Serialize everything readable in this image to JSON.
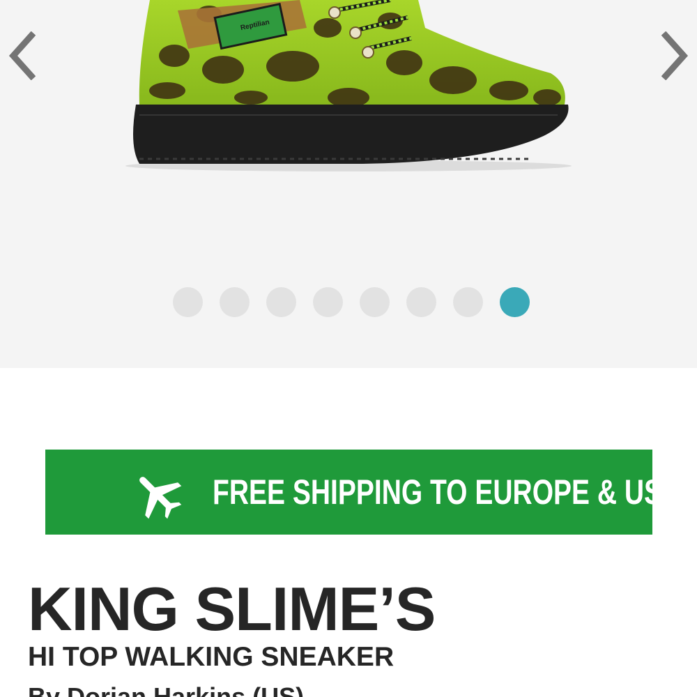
{
  "gallery": {
    "image_alt": "Green leopard print hi top walking sneaker",
    "image_label": "Reptilian",
    "prev_icon": "chevron-left-icon",
    "next_icon": "chevron-right-icon",
    "slide_count": 8,
    "active_slide": 8,
    "dot_color": "#e2e2e2",
    "active_dot_color": "#3aa9b8"
  },
  "banner": {
    "icon": "airplane-icon",
    "text": "FREE SHIPPING TO EUROPE & US",
    "background": "#1f9a3a"
  },
  "product": {
    "title": "KING SLIME’S",
    "subtitle": "HI TOP WALKING SNEAKER",
    "designer": "By Dorian Harkins (US)"
  }
}
